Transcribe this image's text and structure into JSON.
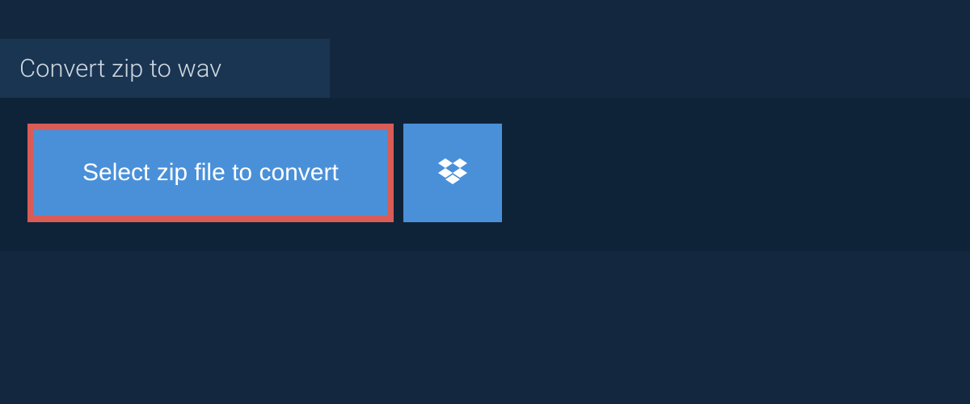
{
  "header": {
    "title": "Convert zip to wav"
  },
  "buttons": {
    "select_label": "Select zip file to convert"
  }
}
